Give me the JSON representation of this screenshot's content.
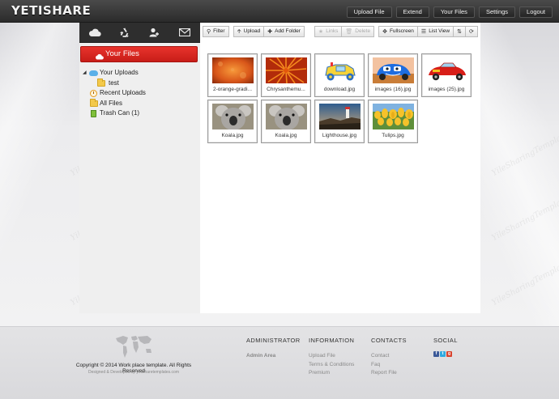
{
  "header": {
    "logo": "YETISHARE",
    "nav": [
      "Upload File",
      "Extend",
      "Your Files",
      "Settings",
      "Logout"
    ]
  },
  "sidebar": {
    "icons": [
      "cloud-icon",
      "recycle-icon",
      "users-icon",
      "envelope-icon"
    ],
    "your_files_label": "Your Files",
    "tree": {
      "your_uploads": "Your Uploads",
      "test": "test",
      "recent_uploads": "Recent Uploads",
      "all_files": "All Files",
      "trash_can": "Trash Can (1)"
    }
  },
  "toolbar": {
    "filter": "Filter",
    "upload": "Upload",
    "add_folder": "Add Folder",
    "links": "Links",
    "delete": "Delete",
    "fullscreen": "Fullscreen",
    "list_view": "List View"
  },
  "files": [
    {
      "name": "2-orange-gradi...",
      "art": "orange-gradient"
    },
    {
      "name": "Chrysanthemu...",
      "art": "chrysanthemum"
    },
    {
      "name": "download.jpg",
      "art": "toy-car"
    },
    {
      "name": "images (16).jpg",
      "art": "blue-car"
    },
    {
      "name": "images (25).jpg",
      "art": "red-car"
    },
    {
      "name": "Koala.jpg",
      "art": "koala"
    },
    {
      "name": "Koala.jpg",
      "art": "koala"
    },
    {
      "name": "Lighthouse.jpg",
      "art": "lighthouse"
    },
    {
      "name": "Tulips.jpg",
      "art": "tulips"
    }
  ],
  "watermark": "YileSharingTemplates.com",
  "footer": {
    "copyright": "Copyright © 2014 Work place template. All Rights Reserved",
    "designed": "Designed & Developed by yetisharetemplates.com",
    "columns": {
      "administrator": {
        "title": "ADMINISTRATOR",
        "links": [
          "Admin Area"
        ]
      },
      "information": {
        "title": "INFORMATION",
        "links": [
          "Upload File",
          "Terms & Conditions",
          "Premium"
        ]
      },
      "contacts": {
        "title": "CONTACTS",
        "links": [
          "Contact",
          "Faq",
          "Report File"
        ]
      },
      "social": {
        "title": "SOCIAL",
        "icons": [
          "facebook-icon",
          "twitter-icon",
          "google-plus-icon"
        ]
      }
    }
  },
  "colors": {
    "accent": "#d9261f",
    "header": "#2b2b2b",
    "page_bg": "#e9e9eb"
  }
}
